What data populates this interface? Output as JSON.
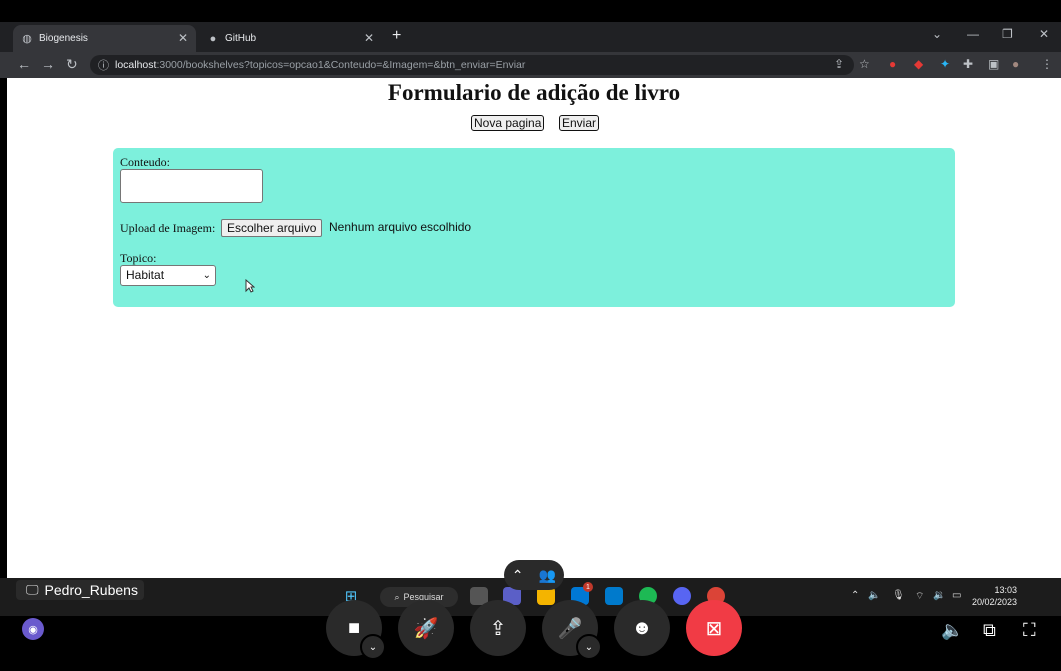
{
  "browser": {
    "tabs": [
      {
        "title": "Biogenesis",
        "icon": "globe-icon"
      },
      {
        "title": "GitHub",
        "icon": "github-icon"
      }
    ],
    "new_tab": "+",
    "url_host": "localhost",
    "url_rest": ":3000/bookshelves?topicos=opcao1&Conteudo=&Imagem=&btn_enviar=Enviar"
  },
  "page": {
    "title": "Formulario de adição de livro",
    "nova_pagina_label": "Nova pagina",
    "enviar_label": "Enviar",
    "form": {
      "conteudo_label": "Conteudo:",
      "upload_label": "Upload de Imagem:",
      "file_button_label": "Escolher arquivo",
      "file_status": "Nenhum arquivo escolhido",
      "topico_label": "Topico:",
      "topico_selected": "Habitat"
    },
    "colors": {
      "form_bg": "#7df0dc"
    }
  },
  "taskbar": {
    "presenter_name": "Pedro_Rubens",
    "search_label": "Pesquisar",
    "time": "13:03",
    "date": "20/02/2023",
    "badge_count": "1"
  },
  "meeting_controls": {
    "colors": {
      "end_button": "#f13b45"
    }
  }
}
